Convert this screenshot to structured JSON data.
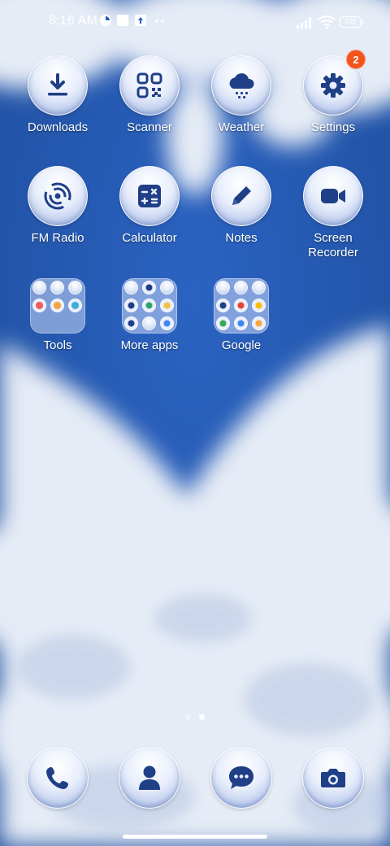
{
  "status_bar": {
    "time": "8:16 AM",
    "battery": "100",
    "left_icons": [
      "data-saver-icon",
      "square-notification-icon",
      "upload-notification-icon",
      "more-dots-icon"
    ],
    "right_icons": [
      "signal-icon",
      "wifi-icon",
      "battery-icon"
    ]
  },
  "home": {
    "apps": [
      {
        "label": "Downloads",
        "icon": "download-icon"
      },
      {
        "label": "Scanner",
        "icon": "qr-scanner-icon"
      },
      {
        "label": "Weather",
        "icon": "cloud-rain-icon"
      },
      {
        "label": "Settings",
        "icon": "gear-icon",
        "badge": "2"
      },
      {
        "label": "FM Radio",
        "icon": "radio-waves-icon"
      },
      {
        "label": "Calculator",
        "icon": "calculator-icon"
      },
      {
        "label": "Notes",
        "icon": "pencil-icon"
      },
      {
        "label": "Screen Recorder",
        "icon": "video-camera-icon"
      }
    ],
    "folders": [
      {
        "label": "Tools"
      },
      {
        "label": "More apps"
      },
      {
        "label": "Google"
      }
    ]
  },
  "page_indicator": {
    "pages": 2,
    "active": 2
  },
  "dock": [
    {
      "name": "phone",
      "icon": "phone-icon"
    },
    {
      "name": "contacts",
      "icon": "person-icon"
    },
    {
      "name": "messages",
      "icon": "chat-bubble-icon"
    },
    {
      "name": "camera",
      "icon": "camera-icon"
    }
  ],
  "colors": {
    "sky": "#2a5fb8",
    "icon_glyph": "#1f3f86",
    "badge": "#f2541b"
  }
}
